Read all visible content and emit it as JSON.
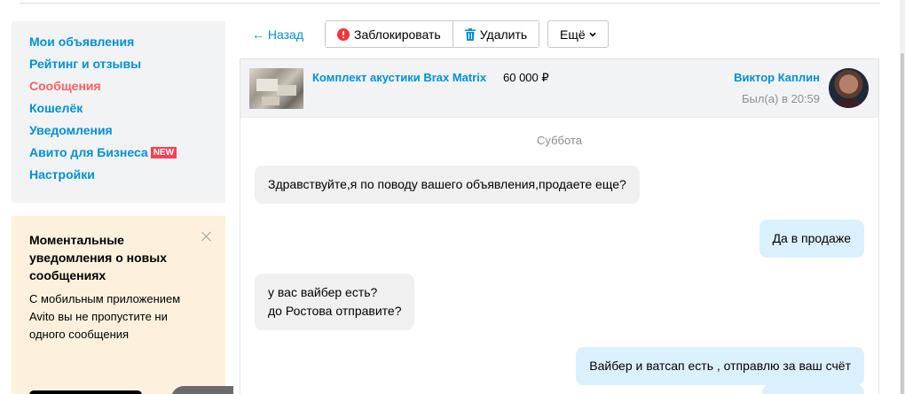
{
  "sidebar": {
    "items": [
      {
        "label": "Мои объявления",
        "active": false
      },
      {
        "label": "Рейтинг и отзывы",
        "active": false
      },
      {
        "label": "Сообщения",
        "active": true
      },
      {
        "label": "Кошелёк",
        "active": false
      },
      {
        "label": "Уведомления",
        "active": false
      },
      {
        "label": "Авито для Бизнеса",
        "active": false,
        "badge": "NEW"
      },
      {
        "label": "Настройки",
        "active": false
      }
    ]
  },
  "promo": {
    "title": "Моментальные уведомления о новых сообщениях",
    "text": "С мобильным приложением Avito вы не пропустите ни одного сообщения"
  },
  "toolbar": {
    "back_label": "← Назад",
    "block_label": "Заблокировать",
    "delete_label": "Удалить",
    "more_label": "Ещё"
  },
  "chat": {
    "ad_title": "Комплект акустики Brax Matrix",
    "ad_price": "60 000 ₽",
    "seller_name": "Виктор Каплин",
    "seller_last_seen": "Был(а) в 20:59",
    "day_label": "Суббота",
    "messages": [
      {
        "direction": "in",
        "text": "Здравствуйте,я по поводу вашего объявления,продаете еще?"
      },
      {
        "direction": "out",
        "text": "Да в продаже"
      },
      {
        "direction": "in",
        "text": "у вас вайбер есть?\nдо Ростова отправите?"
      },
      {
        "direction": "out",
        "text": "Вайбер и ватсап есть , отправлю за ваш счёт"
      },
      {
        "direction": "out",
        "text": ""
      }
    ]
  },
  "colors": {
    "link": "#0091d9",
    "active": "#ff6163",
    "badge": "#ff4053",
    "incoming_bubble": "#f0f0f0",
    "outgoing_bubble": "#dbf0fd",
    "promo_bg": "#fdf1dd"
  },
  "icons": {
    "block": "exclamation-circle-icon",
    "delete": "trash-icon",
    "more": "chevron-down-icon",
    "close": "close-icon"
  }
}
